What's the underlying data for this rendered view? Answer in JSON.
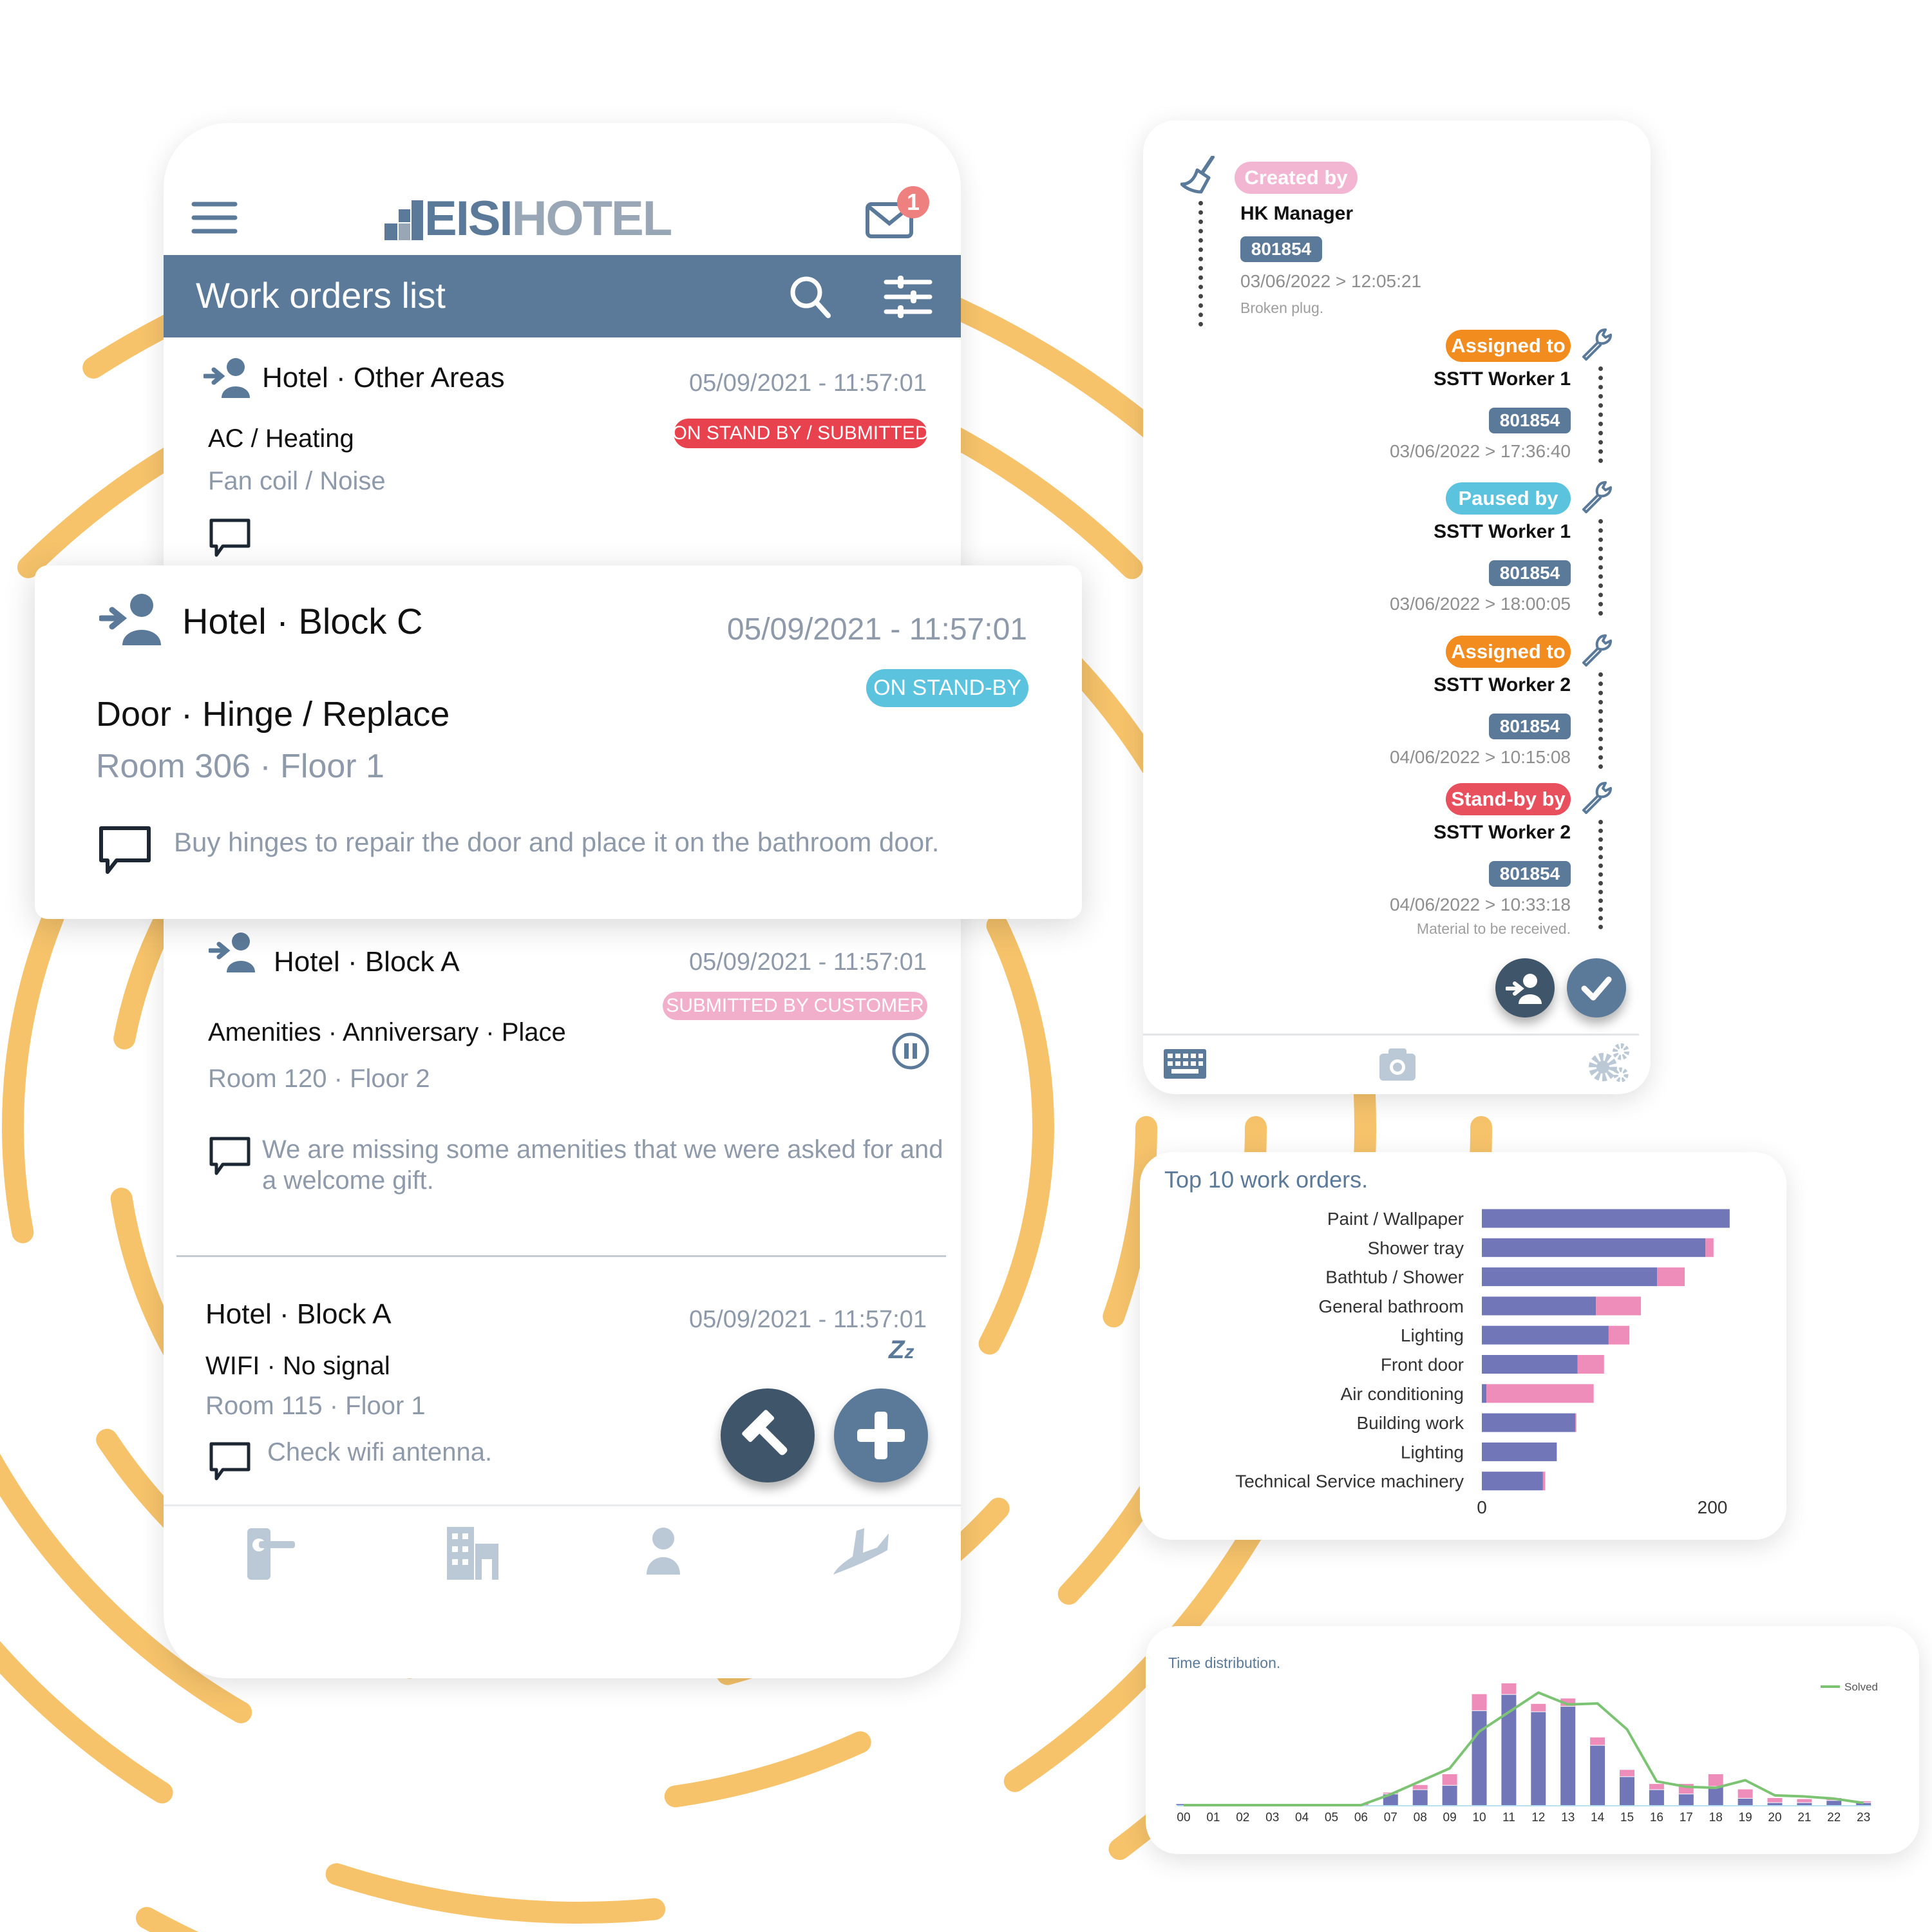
{
  "colors": {
    "primary": "#5B7A99",
    "dark": "#3F5569",
    "accent_orange": "#F6C36B",
    "red": "#E8424E",
    "cyan": "#5BC3DE",
    "pink": "#F2AFCB",
    "orange": "#F28C1E",
    "bar_blue": "#7176B8",
    "bar_pink": "#EE8DBA",
    "solved_green": "#7CC474"
  },
  "app": {
    "logo_left": "EISI",
    "logo_right": "HOTEL",
    "mail_badge": "1",
    "header_title": "Work orders list"
  },
  "work_orders": [
    {
      "location": "Hotel · Other Areas",
      "date": "05/09/2021 - 11:57:01",
      "status": "ON STAND BY / SUBMITTED",
      "category": "AC / Heating",
      "detail": "Fan coil / Noise",
      "comment": ""
    },
    {
      "location": "Hotel · Block C",
      "date": "05/09/2021 - 11:57:01",
      "status": "ON STAND-BY",
      "category": "Door · Hinge / Replace",
      "detail": "Room 306 · Floor 1",
      "comment": "Buy hinges to repair the door and place it on the bathroom door."
    },
    {
      "location": "Hotel · Block A",
      "date": "05/09/2021 - 11:57:01",
      "status": "SUBMITTED BY CUSTOMER",
      "category": "Amenities · Anniversary · Place",
      "detail": "Room 120 · Floor 2",
      "comment_line1": "We are missing some amenities that we were asked for and",
      "comment_line2": "a welcome gift."
    },
    {
      "location": "Hotel · Block A",
      "date": "05/09/2021 - 11:57:01",
      "category": "WIFI · No signal",
      "detail": "Room 115 · Floor 1",
      "comment": "Check wifi antenna."
    }
  ],
  "bottom_nav": [
    "door-handle-icon",
    "building-icon",
    "person-icon",
    "plane-icon"
  ],
  "timeline": [
    {
      "action": "Created by",
      "name": "HK Manager",
      "id": "801854",
      "date": "03/06/2022 > 12:05:21",
      "note": "Broken plug."
    },
    {
      "action": "Assigned to",
      "name": "SSTT Worker 1",
      "id": "801854",
      "date": "03/06/2022 > 17:36:40"
    },
    {
      "action": "Paused by",
      "name": "SSTT Worker 1",
      "id": "801854",
      "date": "03/06/2022 > 18:00:05"
    },
    {
      "action": "Assigned to",
      "name": "SSTT Worker 2",
      "id": "801854",
      "date": "04/06/2022 > 10:15:08"
    },
    {
      "action": "Stand-by by",
      "name": "SSTT Worker 2",
      "id": "801854",
      "date": "04/06/2022 > 10:33:18",
      "note": "Material to be received."
    }
  ],
  "chart_data": [
    {
      "type": "bar",
      "orientation": "horizontal",
      "stacked": true,
      "title": "Top 10 work orders.",
      "categories": [
        "Paint / Wallpaper",
        "Shower tray",
        "Bathtub / Shower",
        "General bathroom",
        "Lighting",
        "Front door",
        "Air conditioning",
        "Building work",
        "Lighting",
        "Technical Service machinery"
      ],
      "series": [
        {
          "values": [
            215,
            194,
            152,
            99,
            110,
            83,
            4,
            81,
            65,
            53
          ],
          "color": "#7176B8"
        },
        {
          "values": [
            0,
            7,
            24,
            39,
            18,
            23,
            93,
            1,
            0,
            2
          ],
          "color": "#EE8DBA"
        }
      ],
      "xticks": [
        "0",
        "200"
      ],
      "xlim": [
        0,
        220
      ],
      "grid": false
    },
    {
      "type": "bar",
      "stacked": true,
      "title": "Time distribution.",
      "categories": [
        "00",
        "01",
        "02",
        "03",
        "04",
        "05",
        "06",
        "07",
        "08",
        "09",
        "10",
        "11",
        "12",
        "13",
        "14",
        "15",
        "16",
        "17",
        "18",
        "19",
        "20",
        "21",
        "22",
        "23"
      ],
      "series": [
        {
          "values": [
            1,
            0,
            0,
            0,
            0,
            0,
            0,
            10,
            14,
            18,
            87,
            102,
            86,
            91,
            55,
            26,
            14,
            10,
            17,
            6,
            2,
            2,
            4,
            2
          ],
          "color": "#7176B8"
        },
        {
          "values": [
            0,
            0,
            0,
            0,
            0,
            0,
            1,
            1,
            4,
            10,
            15,
            10,
            7,
            7,
            7,
            6,
            5,
            9,
            11,
            8,
            4,
            3,
            2,
            1
          ],
          "color": "#EE8DBA"
        },
        {
          "name": "Solved",
          "type": "line",
          "values": [
            0,
            0,
            0,
            0,
            0,
            0,
            0,
            10,
            22,
            34,
            68,
            86,
            104,
            93,
            94,
            70,
            22,
            17,
            16,
            23,
            9,
            8,
            6,
            2
          ],
          "color": "#7CC474"
        }
      ],
      "legend": "top-right",
      "grid": false
    }
  ]
}
